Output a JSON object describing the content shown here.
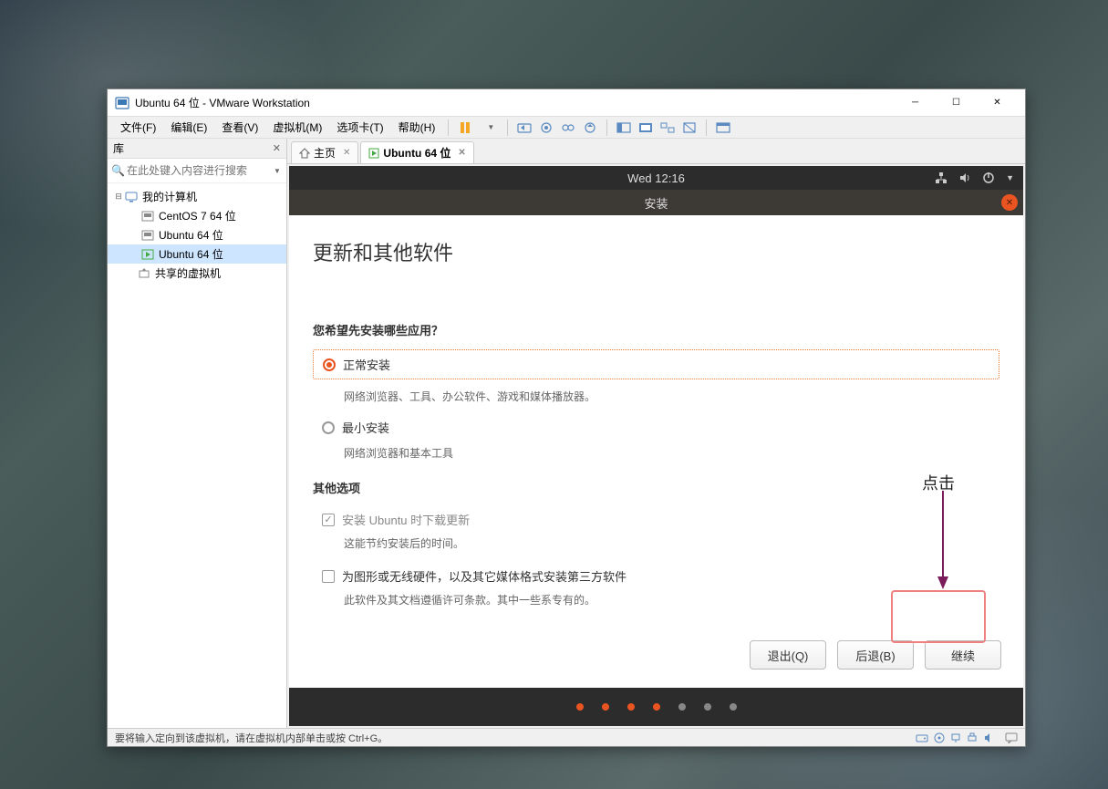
{
  "window": {
    "title": "Ubuntu 64 位 - VMware Workstation"
  },
  "menus": {
    "file": "文件(F)",
    "edit": "编辑(E)",
    "view": "查看(V)",
    "vm": "虚拟机(M)",
    "tabs": "选项卡(T)",
    "help": "帮助(H)"
  },
  "sidebar": {
    "title": "库",
    "search_placeholder": "在此处键入内容进行搜索",
    "my_computer": "我的计算机",
    "items": [
      {
        "label": "CentOS 7 64 位"
      },
      {
        "label": "Ubuntu 64 位"
      },
      {
        "label": "Ubuntu 64 位"
      }
    ],
    "shared": "共享的虚拟机"
  },
  "tabs": {
    "home": "主页",
    "vm": "Ubuntu 64 位"
  },
  "top_panel": {
    "clock": "Wed 12:16"
  },
  "installer": {
    "title": "安装",
    "heading": "更新和其他软件",
    "question": "您希望先安装哪些应用？",
    "normal": {
      "label": "正常安装",
      "desc": "网络浏览器、工具、办公软件、游戏和媒体播放器。"
    },
    "minimal": {
      "label": "最小安装",
      "desc": "网络浏览器和基本工具"
    },
    "other_heading": "其他选项",
    "download_updates": {
      "label": "安装 Ubuntu 时下载更新",
      "desc": "这能节约安装后的时间。"
    },
    "third_party": {
      "label": "为图形或无线硬件，以及其它媒体格式安装第三方软件",
      "desc": "此软件及其文档遵循许可条款。其中一些系专有的。"
    },
    "buttons": {
      "quit": "退出(Q)",
      "back": "后退(B)",
      "continue": "继续"
    }
  },
  "annotation": {
    "label": "点击"
  },
  "statusbar": {
    "text": "要将输入定向到该虚拟机，请在虚拟机内部单击或按 Ctrl+G。"
  }
}
